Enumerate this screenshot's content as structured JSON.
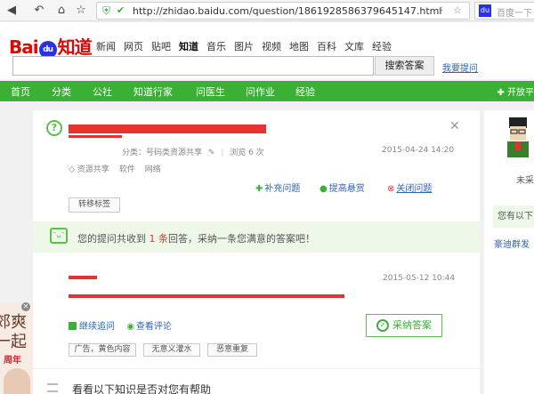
{
  "browser": {
    "url": "http://zhidao.baidu.com/question/1861928586379645147.html",
    "search_placeholder": "百度一下"
  },
  "header": {
    "logo_bai": "Bai",
    "logo_du": "du",
    "logo_zhidao": "知道",
    "channels": [
      "新闻",
      "网页",
      "贴吧",
      "知道",
      "音乐",
      "图片",
      "视频",
      "地图",
      "百科",
      "文库",
      "经验"
    ],
    "search_button": "搜索答案",
    "ask_link": "我要提问"
  },
  "nav": {
    "items": [
      "首页",
      "分类",
      "公社",
      "知道行家",
      "问医生",
      "问作业",
      "经验"
    ],
    "open_platform": "开放平"
  },
  "question": {
    "meta": "分类：号码类资源共享",
    "views": "浏览 6 次",
    "date": "2015-04-24 14:20",
    "tags": [
      "资源共享",
      "软件",
      "网络"
    ],
    "add_question": "补充问题",
    "raise_reward": "提高悬赏",
    "close_question": "关闭问题",
    "move_tag": "转移标签"
  },
  "notice": {
    "prefix": "您的提问共收到",
    "count": "1 条",
    "suffix": "回答，采纳一条您满意的答案吧！"
  },
  "answer": {
    "date": "2015-05-12 10:44",
    "continue_ask": "继续追问",
    "view_comments": "查看评论",
    "adopt": "采纳答案",
    "tags": [
      "广告，黄色内容",
      "无意义灌水",
      "恶意重复"
    ]
  },
  "bottom": {
    "title": "看看以下知识是否对您有帮助"
  },
  "left_ad": {
    "line1": "郊爽",
    "line2": "一起",
    "line3": "周年"
  },
  "sidebar": {
    "unadopted": "未采",
    "you_have": "您有以下",
    "group_link": "豪迪群发"
  }
}
